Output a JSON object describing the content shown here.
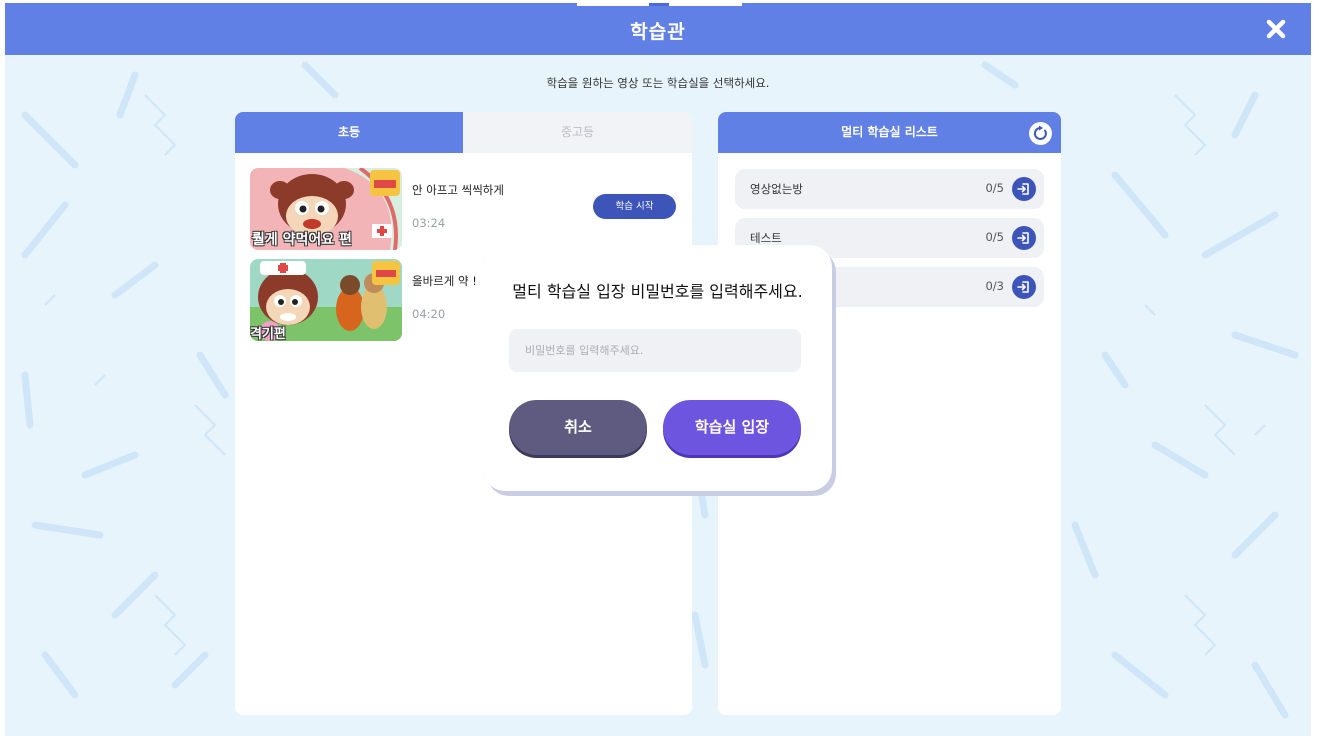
{
  "header": {
    "title": "학습관",
    "close_icon": "close-icon",
    "color": "#6180e6"
  },
  "subtitle": "학습을 원하는 영상 또는 학습실을 선택하세요.",
  "left_panel": {
    "tabs": [
      {
        "label": "초등",
        "active": true
      },
      {
        "label": "중고등",
        "active": false
      }
    ],
    "videos": [
      {
        "title": "안 아프고 씩씩하게",
        "duration": "03:24",
        "thumb_caption": "뤌게 약먹어요 편",
        "start_label": "학습 시작"
      },
      {
        "title": "올바르게 약 !",
        "duration": "04:20",
        "thumb_caption": "격기편"
      }
    ]
  },
  "right_panel": {
    "title": "멀티 학습실 리스트",
    "refresh_icon": "refresh-icon",
    "rooms": [
      {
        "name": "영상없는방",
        "count": "0/5",
        "icon": "enter-icon"
      },
      {
        "name": "테스트",
        "count": "0/5",
        "icon": "enter-icon"
      },
      {
        "name": "",
        "count": "0/3",
        "icon": "enter-icon"
      }
    ]
  },
  "modal": {
    "title": "멀티 학습실 입장 비밀번호를 입력해주세요.",
    "password": {
      "placeholder": "비밀번호를 입력해주세요.",
      "value": ""
    },
    "cancel_label": "취소",
    "enter_label": "학습실 입장"
  },
  "colors": {
    "accent": "#6180e6",
    "dark_button": "#3d55b8",
    "cancel": "#5f5a7f",
    "enter": "#6e55e0",
    "background": "#e8f4fc"
  }
}
